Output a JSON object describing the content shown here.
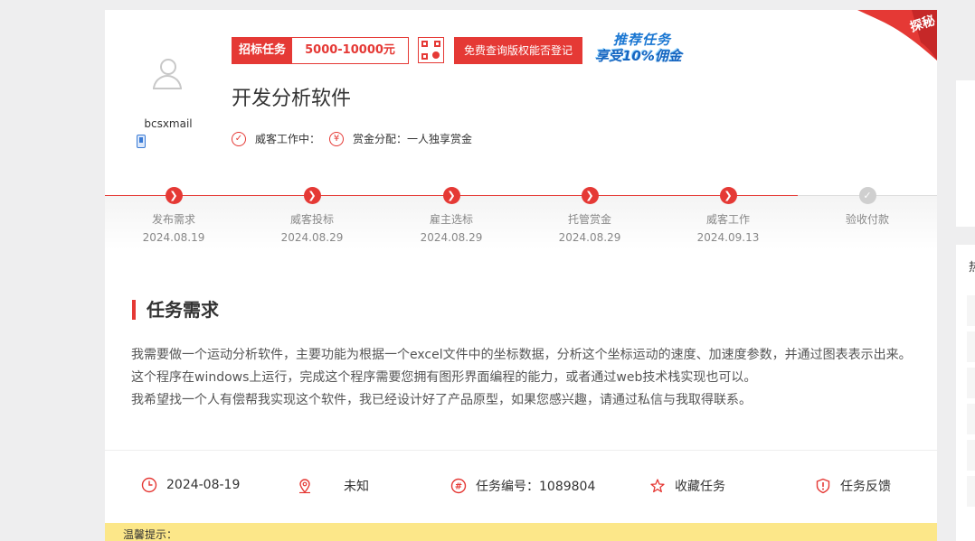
{
  "user": {
    "name": "bcsxmail"
  },
  "bid": {
    "label": "招标任务",
    "amount": "5000-10000元"
  },
  "free_button": "免费查询版权能否登记",
  "promo": {
    "line1": "推荐任务",
    "line2": "享受10%佣金"
  },
  "ribbon": "探秘",
  "task": {
    "title": "开发分析软件",
    "status": "威客工作中：",
    "reward": "赏金分配：一人独享赏金"
  },
  "steps": [
    {
      "name": "发布需求",
      "date": "2024.08.19"
    },
    {
      "name": "威客投标",
      "date": "2024.08.29"
    },
    {
      "name": "雇主选标",
      "date": "2024.08.29"
    },
    {
      "name": "托管赏金",
      "date": "2024.08.29"
    },
    {
      "name": "威客工作",
      "date": "2024.09.13"
    },
    {
      "name": "验收付款",
      "date": ""
    }
  ],
  "section_title": "任务需求",
  "description": [
    "我需要做一个运动分析软件，主要功能为根据一个excel文件中的坐标数据，分析这个坐标运动的速度、加速度参数，并通过图表表示出来。",
    "这个程序在windows上运行，完成这个程序需要您拥有图形界面编程的能力，或者通过web技术栈实现也可以。",
    "我希望找一个人有偿帮我实现这个软件，我已经设计好了产品原型，如果您感兴趣，请通过私信与我取得联系。"
  ],
  "info": {
    "date": "2024-08-19",
    "location": "未知",
    "task_no": "任务编号：1089804",
    "favorite": "收藏任务",
    "feedback": "任务反馈"
  },
  "tip": "温馨提示：",
  "sidebar_partial": "热",
  "colors": {
    "accent": "#e53935",
    "promo_blue": "#1976d2",
    "tip_bg": "#fce789"
  }
}
